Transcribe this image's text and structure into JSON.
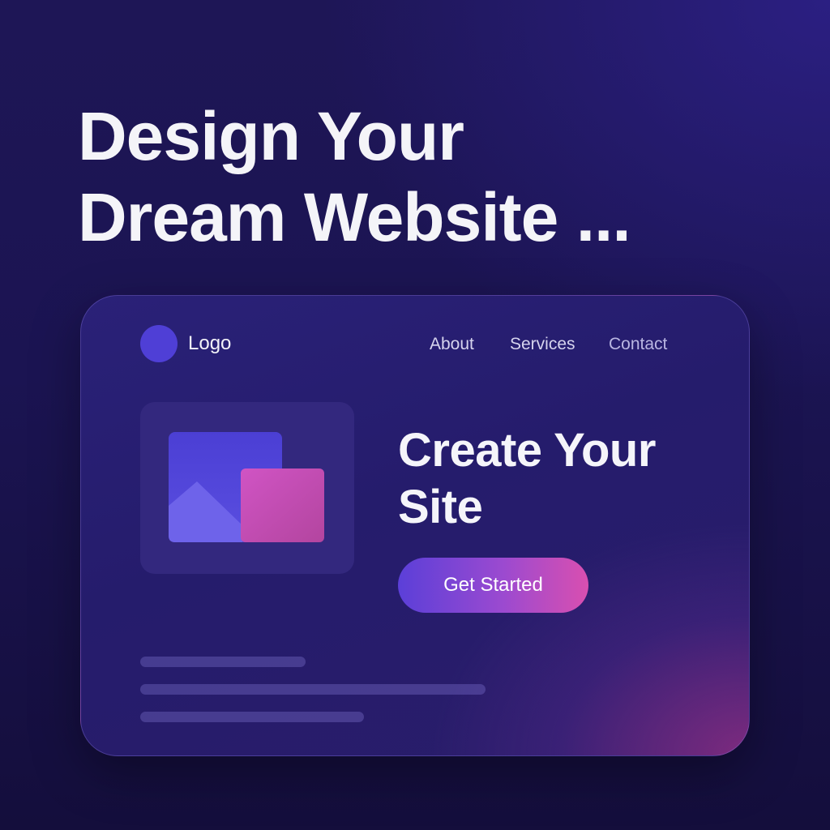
{
  "headline": {
    "line1": "Design Your",
    "line2": "Dream Website ..."
  },
  "mockup": {
    "logo": {
      "icon": "circle-logo-icon",
      "label": "Logo",
      "color": "#4f3fd6"
    },
    "nav": [
      {
        "label": "About"
      },
      {
        "label": "Services"
      },
      {
        "label": "Contact"
      }
    ],
    "image_placeholder": {
      "icon": "image-placeholder-icon",
      "colors": {
        "back": "#5447d8",
        "front": "#c34fbe",
        "tile": "#33287e"
      }
    },
    "hero": {
      "title_line1": "Create Your",
      "title_line2": "Site",
      "cta_label": "Get Started",
      "cta_gradient": [
        "#5b3fd8",
        "#d94fb0"
      ]
    },
    "text_placeholder_lines": 3
  },
  "colors": {
    "background": "#1b1452",
    "card": "#2a2178",
    "accent_pink": "#d94fb0",
    "accent_purple": "#5b3fd8"
  }
}
